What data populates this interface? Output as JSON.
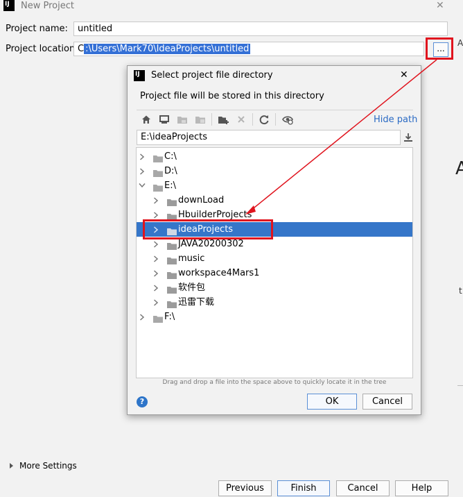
{
  "window": {
    "title": "New Project",
    "close_glyph": "✕",
    "logo_text": "IJ"
  },
  "form": {
    "name_label": "Project name:",
    "name_value": "untitled",
    "location_label": "Project location:",
    "location_prefix": "C",
    "location_selected": ":\\Users\\Mark70\\IdeaProjects\\untitled",
    "browse_label": "..."
  },
  "dialog": {
    "title": "Select project file directory",
    "close_glyph": "✕",
    "logo_text": "IJ",
    "description": "Project file will be stored in this directory",
    "hide_path": "Hide path",
    "path_value": "E:\\ideaProjects",
    "hint": "Drag and drop a file into the space above to quickly locate it in the tree",
    "help_glyph": "?",
    "ok": "OK",
    "cancel": "Cancel",
    "toolbar_icons": [
      "home-icon",
      "desktop-icon",
      "project-folder-icon",
      "module-folder-icon",
      "new-folder-icon",
      "delete-icon",
      "refresh-icon",
      "show-hidden-icon"
    ]
  },
  "tree": [
    {
      "label": "C:\\",
      "level": 0,
      "expanded": false,
      "selected": false,
      "kind": "drive"
    },
    {
      "label": "D:\\",
      "level": 0,
      "expanded": false,
      "selected": false,
      "kind": "drive"
    },
    {
      "label": "E:\\",
      "level": 0,
      "expanded": true,
      "selected": false,
      "kind": "drive"
    },
    {
      "label": "downLoad",
      "level": 1,
      "expanded": false,
      "selected": false,
      "kind": "folder"
    },
    {
      "label": "HbuilderProjects",
      "level": 1,
      "expanded": false,
      "selected": false,
      "kind": "folder"
    },
    {
      "label": "ideaProjects",
      "level": 1,
      "expanded": false,
      "selected": true,
      "kind": "folder"
    },
    {
      "label": "JAVA20200302",
      "level": 1,
      "expanded": false,
      "selected": false,
      "kind": "folder"
    },
    {
      "label": "music",
      "level": 1,
      "expanded": false,
      "selected": false,
      "kind": "folder"
    },
    {
      "label": "workspace4Mars1",
      "level": 1,
      "expanded": false,
      "selected": false,
      "kind": "folder"
    },
    {
      "label": "软件包",
      "level": 1,
      "expanded": false,
      "selected": false,
      "kind": "folder"
    },
    {
      "label": "迅雷下载",
      "level": 1,
      "expanded": false,
      "selected": false,
      "kind": "folder"
    },
    {
      "label": "F:\\",
      "level": 0,
      "expanded": false,
      "selected": false,
      "kind": "drive"
    }
  ],
  "bottom": {
    "more_settings": "More Settings",
    "previous": "Previous",
    "finish": "Finish",
    "cancel": "Cancel",
    "help": "Help"
  },
  "right_edge": {
    "glyph_a_upper": "A",
    "glyph_a_large": "A",
    "glyph_t": "t"
  },
  "colors": {
    "selection": "#3576c9",
    "text_selection": "#3470d6",
    "annotation_red": "#e0141e",
    "link": "#2a6ac4"
  }
}
